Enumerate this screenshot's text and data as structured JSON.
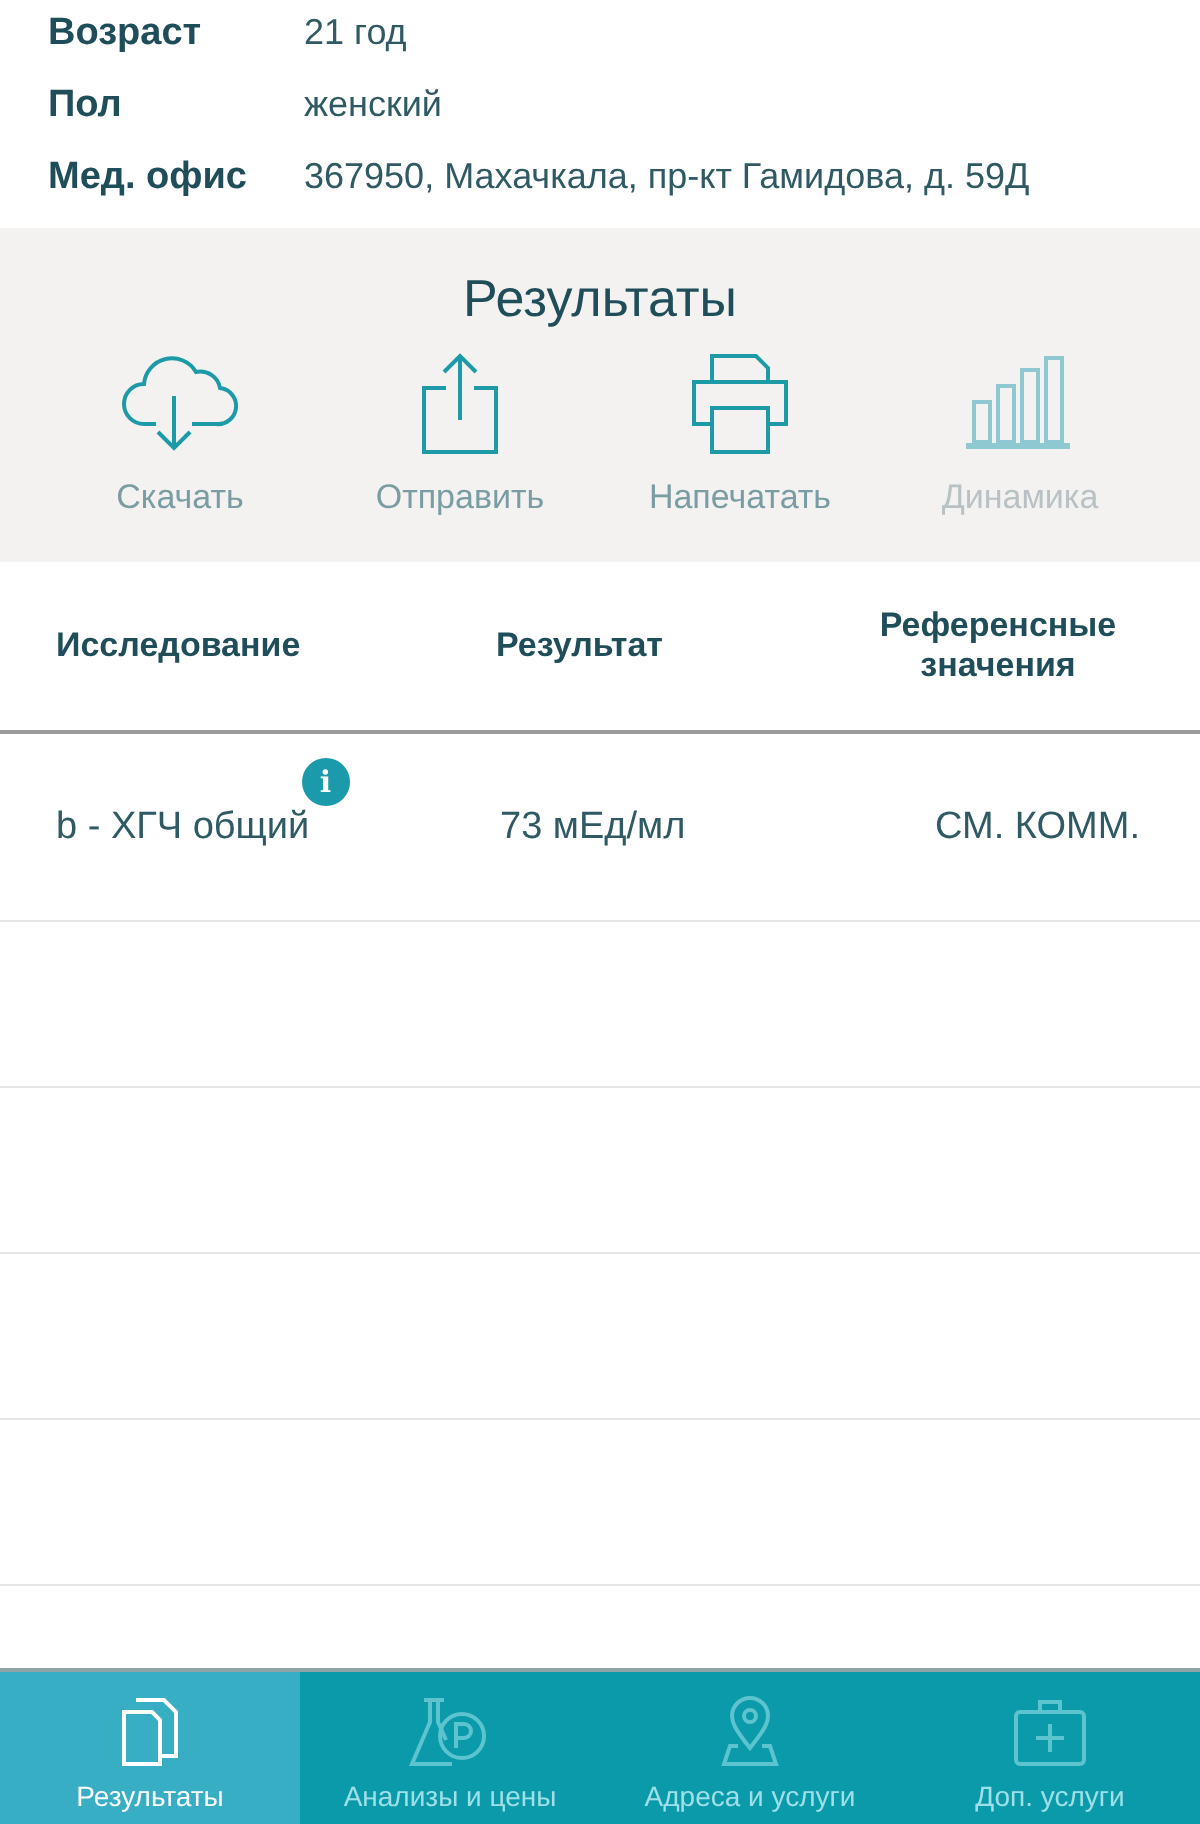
{
  "patient_info": [
    {
      "label": "Возраст",
      "value": "21 год"
    },
    {
      "label": "Пол",
      "value": "женский"
    },
    {
      "label": "Мед. офис",
      "value": "367950, Махачкала, пр-кт Гамидова, д. 59Д"
    }
  ],
  "results_panel": {
    "title": "Результаты",
    "actions": [
      {
        "kind": "download",
        "label": "Скачать",
        "disabled": false
      },
      {
        "kind": "share",
        "label": "Отправить",
        "disabled": false
      },
      {
        "kind": "print",
        "label": "Напечатать",
        "disabled": false
      },
      {
        "kind": "chart",
        "label": "Динамика",
        "disabled": true
      }
    ]
  },
  "table": {
    "columns": [
      "Исследование",
      "Результат",
      "Референсные значения"
    ],
    "rows": [
      {
        "test": "b - ХГЧ общий",
        "info_badge": "i",
        "result": "73 мЕд/мл",
        "reference": "СМ. КОММ."
      }
    ]
  },
  "tab_bar": [
    {
      "kind": "results",
      "label": "Результаты",
      "selected": true
    },
    {
      "kind": "tests",
      "label": "Анализы и цены",
      "selected": false
    },
    {
      "kind": "addresses",
      "label": "Адреса и услуги",
      "selected": false
    },
    {
      "kind": "services",
      "label": "Доп. услуги",
      "selected": false
    }
  ]
}
